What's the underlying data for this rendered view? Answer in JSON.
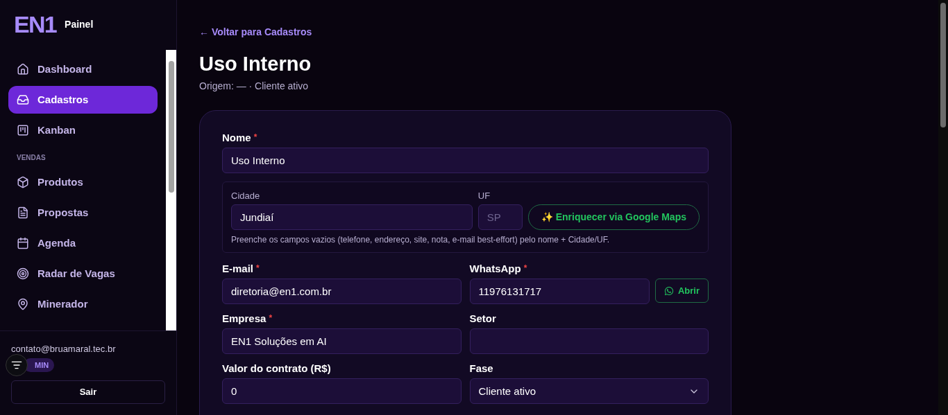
{
  "sidebar": {
    "logo": "EN1",
    "app_label": "Painel",
    "sections": [
      {
        "items": [
          {
            "label": "Dashboard",
            "selected": false
          },
          {
            "label": "Cadastros",
            "selected": true
          },
          {
            "label": "Kanban",
            "selected": false
          }
        ]
      },
      {
        "heading": "VENDAS",
        "items": [
          {
            "label": "Produtos",
            "selected": false
          },
          {
            "label": "Propostas",
            "selected": false
          },
          {
            "label": "Agenda",
            "selected": false
          },
          {
            "label": "Radar de Vagas",
            "selected": false
          },
          {
            "label": "Minerador",
            "selected": false
          }
        ]
      }
    ],
    "user_email": "contato@bruamaral.tec.br",
    "role_badge": "MIN",
    "logout_button": "Sair"
  },
  "main": {
    "back_link": "← Voltar para Cadastros",
    "title": "Uso Interno",
    "subtitle": "Origem: — · Cliente ativo",
    "form": {
      "name": {
        "label": "Nome",
        "required_mark": "*",
        "value": "Uso Interno"
      },
      "address": {
        "city_label": "Cidade",
        "city_value": "Jundiaí",
        "uf_label": "UF",
        "uf_placeholder": "SP",
        "enrich_button": "✨ Enriquecer via Google Maps",
        "hint": "Preenche os campos vazios (telefone, endereço, site, nota, e-mail best-effort) pelo nome + Cidade/UF."
      },
      "rows": [
        [
          {
            "kind": "input",
            "label": "E-mail",
            "required_mark": "*",
            "value": "diretoria@en1.com.br"
          },
          {
            "kind": "whatsapp",
            "label": "WhatsApp",
            "required_mark": "*",
            "value": "11976131717",
            "button": "Abrir"
          }
        ],
        [
          {
            "kind": "input",
            "label": "Empresa",
            "required_mark": "*",
            "value": "EN1 Soluções em AI"
          },
          {
            "kind": "input",
            "label": "Setor"
          }
        ],
        [
          {
            "kind": "input",
            "label": "Valor do contrato (R$)",
            "value": "0"
          },
          {
            "kind": "select",
            "label": "Fase",
            "value": "Cliente ativo"
          }
        ]
      ]
    }
  }
}
